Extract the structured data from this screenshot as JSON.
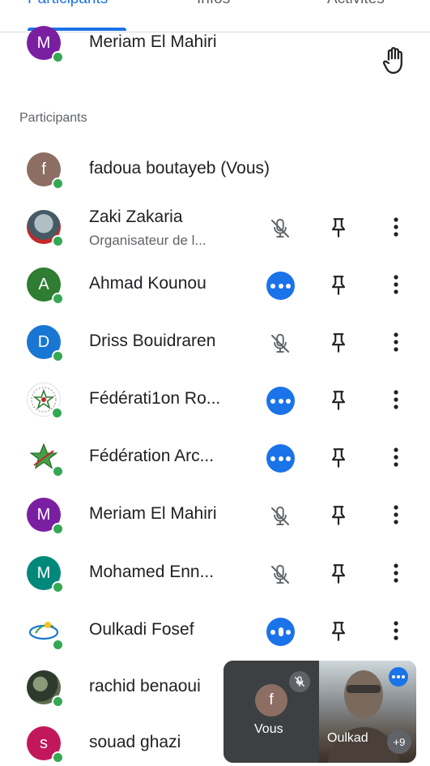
{
  "tabs": [
    {
      "label": "Participants",
      "active": true
    },
    {
      "label": "Infos",
      "active": false
    },
    {
      "label": "Activités",
      "active": false
    }
  ],
  "raised_hand": {
    "name": "Meriam El Mahiri",
    "initial": "M",
    "color": "#7b1fa2"
  },
  "section_label": "Participants",
  "participants": [
    {
      "name": "fadoua boutayeb (Vous)",
      "initial": "f",
      "color": "#8d6e63"
    },
    {
      "name": "Zaki Zakaria",
      "subtitle": "Organisateur de l...",
      "photo": true,
      "mic": "muted"
    },
    {
      "name": "Ahmad Kounou",
      "initial": "A",
      "color": "#2e7d32",
      "mic": "speaking"
    },
    {
      "name": "Driss Bouidraren",
      "initial": "D",
      "color": "#1976d2",
      "mic": "muted"
    },
    {
      "name": "Fédérati1on Ro...",
      "logo": true,
      "mic": "speaking"
    },
    {
      "name": "Fédération Arc...",
      "logo": true,
      "mic": "speaking"
    },
    {
      "name": "Meriam El Mahiri",
      "initial": "M",
      "color": "#7b1fa2",
      "mic": "muted"
    },
    {
      "name": "Mohamed Enn...",
      "initial": "M",
      "color": "#00897b",
      "mic": "muted"
    },
    {
      "name": "Oulkadi Fosef",
      "logo": true,
      "mic": "speaking"
    },
    {
      "name": "rachid benaoui",
      "photo": true
    },
    {
      "name": "souad ghazi",
      "initial": "s",
      "color": "#c2185b"
    }
  ],
  "pip": {
    "self_label": "Vous",
    "self_initial": "f",
    "remote_label": "Oulkad",
    "more_count": "+9"
  },
  "colors": {
    "accent": "#1a73e8",
    "online": "#34a853",
    "icon": "#3c4043"
  }
}
